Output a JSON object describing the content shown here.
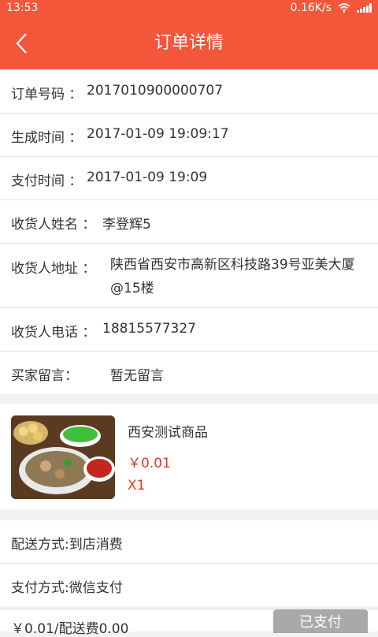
{
  "status_bar": {
    "time": "13:53",
    "network_speed": "0.16K/s"
  },
  "header": {
    "title": "订单详情"
  },
  "order_info": {
    "order_no_label": "订单号码 ：",
    "order_no": "2017010900000707",
    "created_label": "生成时间 ：",
    "created": "2017-01-09 19:09:17",
    "paid_label": "支付时间 ：",
    "paid": "2017-01-09 19:09",
    "name_label": "收货人姓名 ：",
    "name": "李登辉5",
    "address_label": "收货人地址 ：",
    "address": "陕西省西安市高新区科技路39号亚美大厦@15楼",
    "phone_label": "收货人电话 ：",
    "phone": "18815577327",
    "message_label": "买家留言：",
    "message": "暂无留言"
  },
  "product": {
    "name": "西安测试商品",
    "price": "￥0.01",
    "qty": "X1"
  },
  "delivery": {
    "method": "配送方式:到店消费",
    "payment": "支付方式:微信支付"
  },
  "footer": {
    "total": "￥0.01/配送费0.00",
    "button": "已支付"
  },
  "colors": {
    "accent": "#f4563a",
    "price": "#e03a24",
    "button_disabled": "#a9a9a9"
  }
}
